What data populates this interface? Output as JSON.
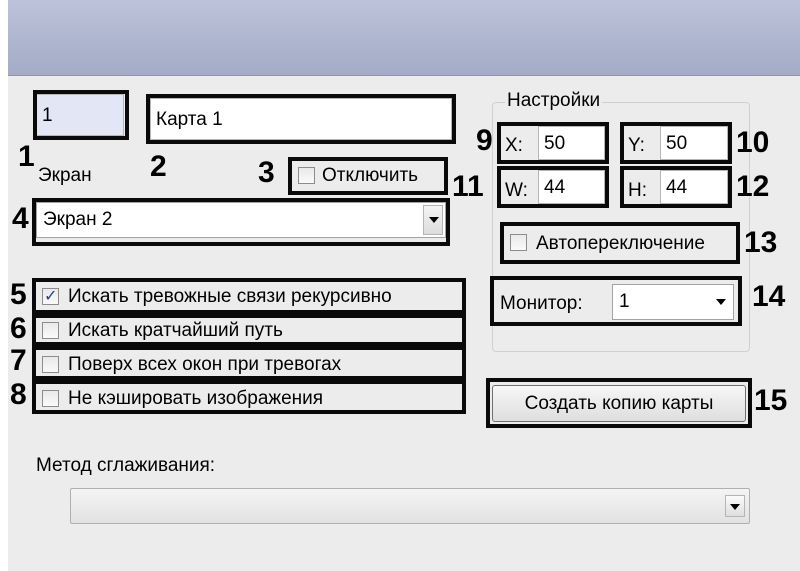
{
  "fields": {
    "screen_number": "1",
    "map_name": "Карта 1",
    "screen_label": "Экран",
    "screen_select": "Экран 2",
    "disable_label": "Отключить"
  },
  "settings": {
    "title": "Настройки",
    "x_label": "X:",
    "x_value": "50",
    "y_label": "Y:",
    "y_value": "50",
    "w_label": "W:",
    "w_value": "44",
    "h_label": "H:",
    "h_value": "44",
    "auto_switch": "Автопереключение",
    "monitor_label": "Монитор:",
    "monitor_value": "1",
    "copy_button": "Создать копию карты"
  },
  "options": [
    {
      "label": "Искать тревожные связи рекурсивно",
      "checked": true
    },
    {
      "label": "Искать кратчайший путь",
      "checked": false
    },
    {
      "label": "Поверх всех окон при тревогах",
      "checked": false
    },
    {
      "label": "Не кэшировать изображения",
      "checked": false
    }
  ],
  "smoothing": {
    "label": "Метод сглаживания:",
    "value": ""
  },
  "callouts": [
    "1",
    "2",
    "3",
    "4",
    "5",
    "6",
    "7",
    "8",
    "9",
    "10",
    "11",
    "12",
    "13",
    "14",
    "15"
  ],
  "colors": {
    "titlebar": "#a9b1cb",
    "panel": "#ececec",
    "check": "#1e3f8a"
  }
}
